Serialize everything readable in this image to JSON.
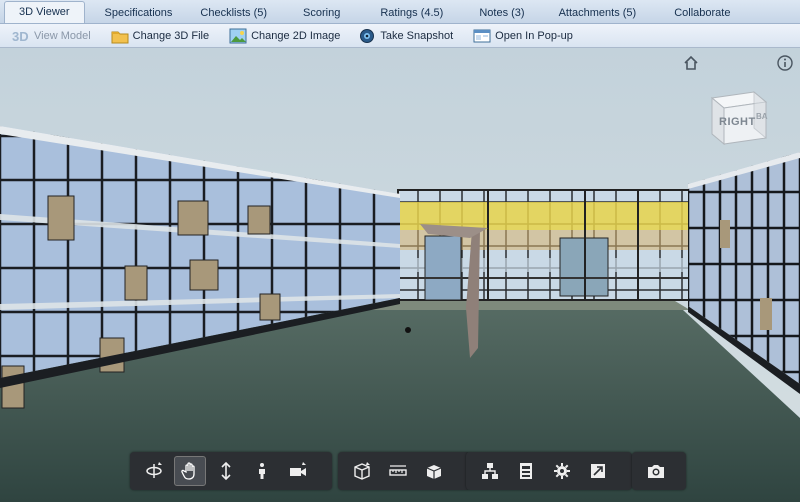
{
  "tabs": [
    {
      "label": "3D Viewer",
      "active": true
    },
    {
      "label": "Specifications"
    },
    {
      "label": "Checklists (5)"
    },
    {
      "label": "Scoring"
    },
    {
      "label": "Ratings (4.5)"
    },
    {
      "label": "Notes (3)"
    },
    {
      "label": "Attachments (5)"
    },
    {
      "label": "Collaborate"
    }
  ],
  "toolbar": {
    "view_model": "View Model",
    "change_3d": "Change 3D File",
    "change_2d": "Change 2D Image",
    "snapshot": "Take Snapshot",
    "popup": "Open In Pop-up"
  },
  "viewcube": {
    "face_label": "RIGHT",
    "side_label": "BA"
  },
  "nav_tools": {
    "group1": [
      "orbit-icon",
      "pan-hand-icon",
      "zoom-icon",
      "first-person-icon",
      "camera-icon"
    ],
    "group2": [
      "section-box-icon",
      "measure-icon",
      "explode-icon"
    ],
    "group3": [
      "model-browser-icon",
      "properties-icon",
      "settings-icon",
      "fullscreen-icon"
    ],
    "group4": [
      "snapshot-camera-icon"
    ]
  },
  "colors": {
    "accent": "#3a6fb3",
    "toolbar_bg": "#2c2f33",
    "ground": "#3f5550"
  }
}
